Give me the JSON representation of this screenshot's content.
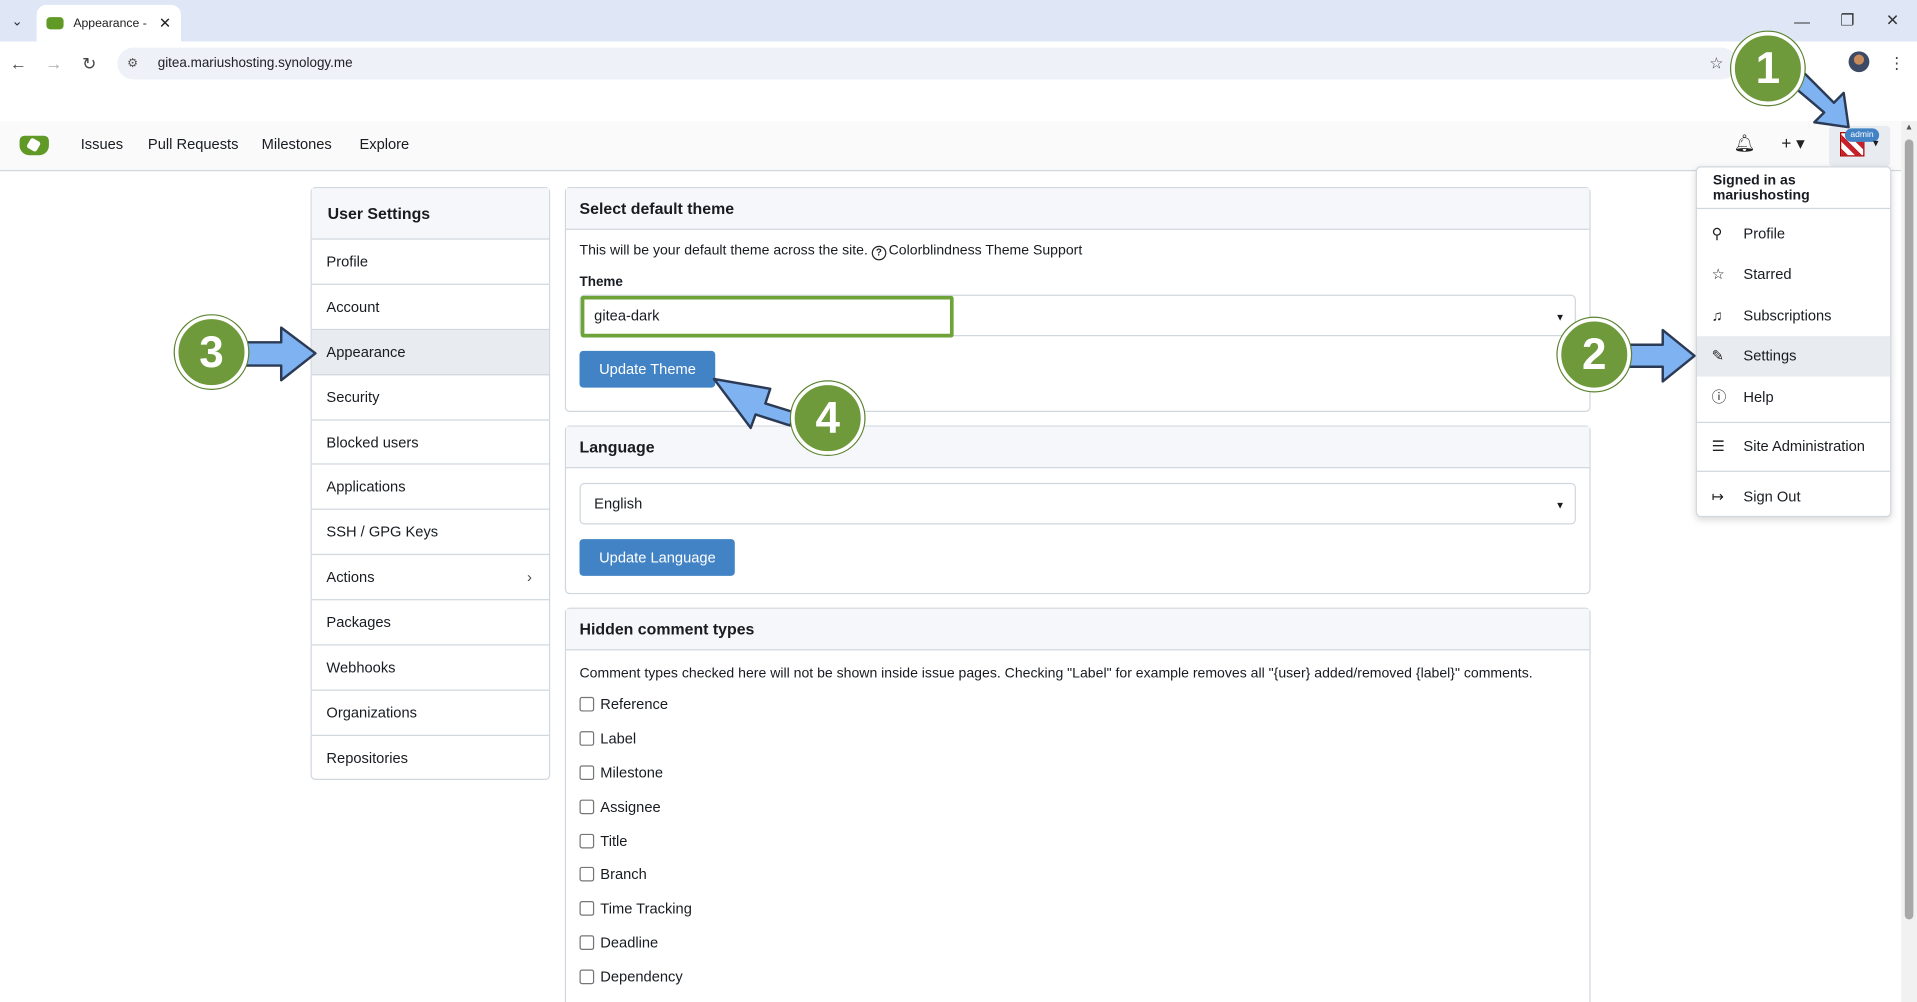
{
  "browser": {
    "tab_title": "Appearance - ",
    "url": "gitea.mariushosting.synology.me"
  },
  "navbar": {
    "links": [
      "Issues",
      "Pull Requests",
      "Milestones",
      "Explore"
    ],
    "avatar_badge": "admin"
  },
  "sidebar": {
    "title": "User Settings",
    "items": [
      {
        "label": "Profile"
      },
      {
        "label": "Account"
      },
      {
        "label": "Appearance",
        "active": true
      },
      {
        "label": "Security"
      },
      {
        "label": "Blocked users"
      },
      {
        "label": "Applications"
      },
      {
        "label": "SSH / GPG Keys"
      },
      {
        "label": "Actions",
        "has_submenu": true
      },
      {
        "label": "Packages"
      },
      {
        "label": "Webhooks"
      },
      {
        "label": "Organizations"
      },
      {
        "label": "Repositories"
      }
    ]
  },
  "theme_section": {
    "title": "Select default theme",
    "description": "This will be your default theme across the site.",
    "help_link": "Colorblindness Theme Support",
    "field_label": "Theme",
    "selected_value": "gitea-dark",
    "button_label": "Update Theme"
  },
  "language_section": {
    "title": "Language",
    "selected_value": "English",
    "button_label": "Update Language"
  },
  "hidden_comments_section": {
    "title": "Hidden comment types",
    "description": "Comment types checked here will not be shown inside issue pages. Checking \"Label\" for example removes all \"{user} added/removed {label}\" comments.",
    "options": [
      "Reference",
      "Label",
      "Milestone",
      "Assignee",
      "Title",
      "Branch",
      "Time Tracking",
      "Deadline",
      "Dependency"
    ]
  },
  "user_menu": {
    "header": "Signed in as mariushosting",
    "items": [
      {
        "label": "Profile",
        "icon": "person-icon"
      },
      {
        "label": "Starred",
        "icon": "star-icon"
      },
      {
        "label": "Subscriptions",
        "icon": "bell-icon"
      },
      {
        "label": "Settings",
        "icon": "tools-icon",
        "active": true
      },
      {
        "label": "Help",
        "icon": "question-icon"
      },
      {
        "label": "Site Administration",
        "icon": "server-icon"
      },
      {
        "label": "Sign Out",
        "icon": "sign-out-icon"
      }
    ]
  },
  "callouts": [
    "1",
    "2",
    "3",
    "4"
  ],
  "colors": {
    "accent_blue": "#4183c4",
    "callout_green": "#6e9a3b",
    "arrow_blue": "#7fb2f0",
    "gitea_green": "#609926"
  }
}
